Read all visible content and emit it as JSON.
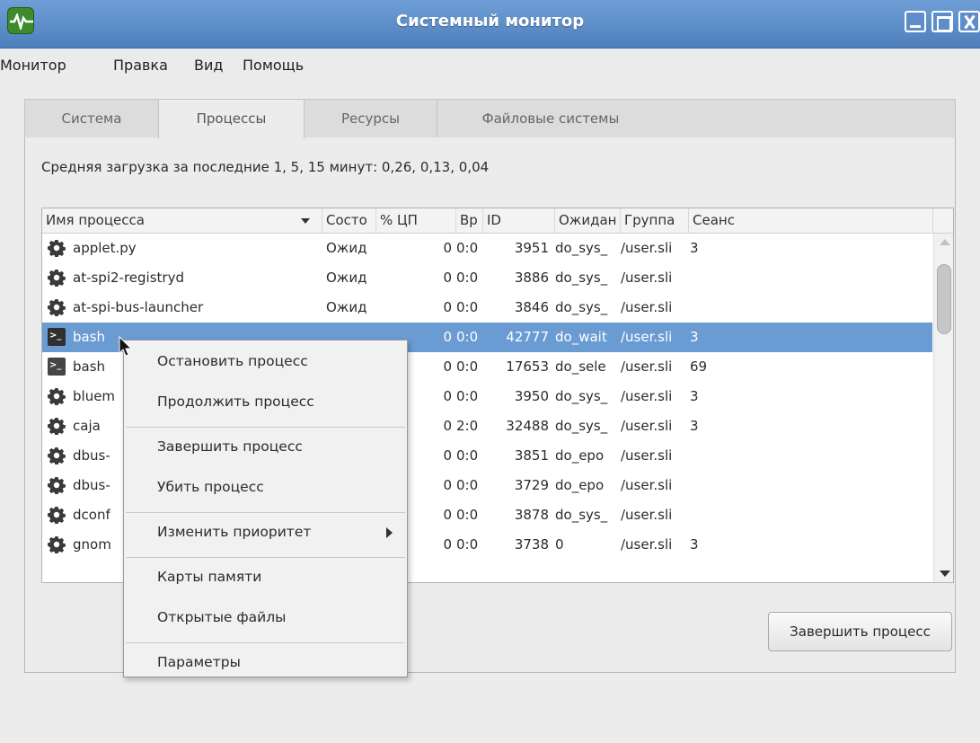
{
  "window": {
    "title": "Системный монитор",
    "icon": "system-monitor-icon"
  },
  "menubar": {
    "items": [
      "Монитор",
      "Правка",
      "Вид",
      "Помощь"
    ]
  },
  "tabs": [
    {
      "label": "Система",
      "active": false
    },
    {
      "label": "Процессы",
      "active": true
    },
    {
      "label": "Ресурсы",
      "active": false
    },
    {
      "label": "Файловые системы",
      "active": false
    }
  ],
  "load_average": "Средняя загрузка за последние 1, 5, 15 минут: 0,26, 0,13, 0,04",
  "table": {
    "columns": [
      "Имя процесса",
      "Состо",
      "% ЦП",
      "Вр",
      "ID",
      "Ожидан",
      "Группа",
      "Сеанс"
    ],
    "rows": [
      {
        "icon": "gear-icon",
        "name": "applet.py",
        "state": "Ожид",
        "cpu": "0",
        "time": "0:0",
        "pid": "3951",
        "wait": "do_sys_",
        "group": "/user.sli",
        "session": "3"
      },
      {
        "icon": "gear-icon",
        "name": "at-spi2-registryd",
        "state": "Ожид",
        "cpu": "0",
        "time": "0:0",
        "pid": "3886",
        "wait": "do_sys_",
        "group": "/user.sli",
        "session": ""
      },
      {
        "icon": "gear-icon",
        "name": "at-spi-bus-launcher",
        "state": "Ожид",
        "cpu": "0",
        "time": "0:0",
        "pid": "3846",
        "wait": "do_sys_",
        "group": "/user.sli",
        "session": ""
      },
      {
        "icon": "terminal-icon",
        "name": "bash",
        "state": "",
        "cpu": "0",
        "time": "0:0",
        "pid": "42777",
        "wait": "do_wait",
        "group": "/user.sli",
        "session": "3",
        "selected": true
      },
      {
        "icon": "terminal-icon",
        "name": "bash",
        "state": "",
        "cpu": "0",
        "time": "0:0",
        "pid": "17653",
        "wait": "do_sele",
        "group": "/user.sli",
        "session": "69"
      },
      {
        "icon": "gear-icon",
        "name": "bluem",
        "state": "",
        "cpu": "0",
        "time": "0:0",
        "pid": "3950",
        "wait": "do_sys_",
        "group": "/user.sli",
        "session": "3"
      },
      {
        "icon": "gear-icon",
        "name": "caja",
        "state": "",
        "cpu": "0",
        "time": "2:0",
        "pid": "32488",
        "wait": "do_sys_",
        "group": "/user.sli",
        "session": "3"
      },
      {
        "icon": "gear-icon",
        "name": "dbus-",
        "state": "",
        "cpu": "0",
        "time": "0:0",
        "pid": "3851",
        "wait": "do_epo",
        "group": "/user.sli",
        "session": ""
      },
      {
        "icon": "gear-icon",
        "name": "dbus-",
        "state": "",
        "cpu": "0",
        "time": "0:0",
        "pid": "3729",
        "wait": "do_epo",
        "group": "/user.sli",
        "session": ""
      },
      {
        "icon": "gear-icon",
        "name": "dconf",
        "state": "",
        "cpu": "0",
        "time": "0:0",
        "pid": "3878",
        "wait": "do_sys_",
        "group": "/user.sli",
        "session": ""
      },
      {
        "icon": "gear-icon",
        "name": "gnom",
        "state": "",
        "cpu": "0",
        "time": "0:0",
        "pid": "3738",
        "wait": "0",
        "group": "/user.sli",
        "session": "3"
      }
    ]
  },
  "end_process_button": "Завершить процесс",
  "context_menu": {
    "items": [
      {
        "label": "Остановить процесс",
        "submenu": false
      },
      {
        "label": "Продолжить процесс",
        "submenu": false
      },
      {
        "separator": true
      },
      {
        "label": "Завершить процесс",
        "submenu": false
      },
      {
        "label": "Убить процесс",
        "submenu": false
      },
      {
        "separator": true
      },
      {
        "label": "Изменить приоритет",
        "submenu": true
      },
      {
        "separator": true
      },
      {
        "label": "Карты памяти",
        "submenu": false
      },
      {
        "label": "Открытые файлы",
        "submenu": false
      },
      {
        "separator": true
      },
      {
        "label": "Параметры",
        "submenu": false
      }
    ]
  },
  "colors": {
    "titlebar": "#5d8ecb",
    "selection": "#6a9bd3"
  }
}
